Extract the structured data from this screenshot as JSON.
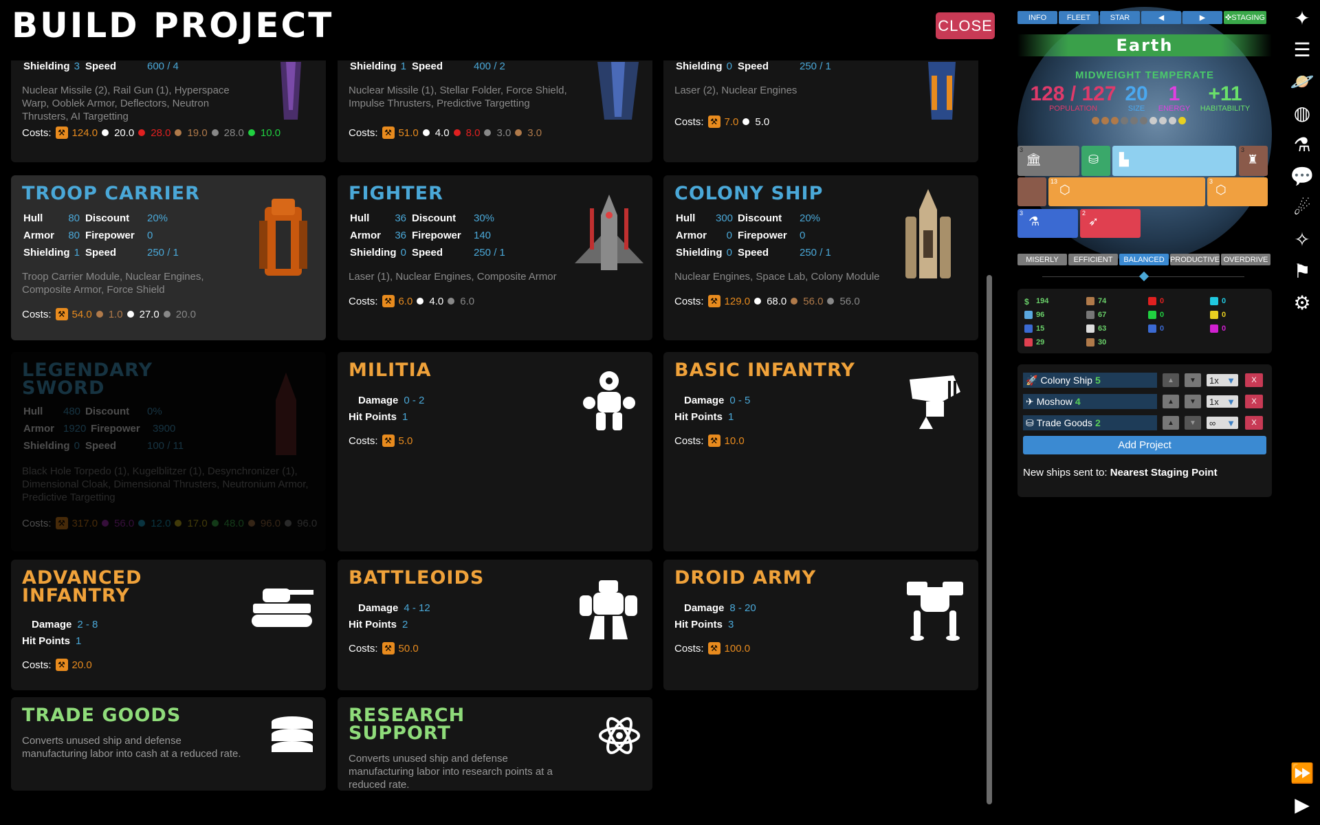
{
  "header": {
    "title": "Build Project",
    "close_label": "CLOSE"
  },
  "top_cards": [
    {
      "shielding": "3",
      "speed": "600 / 4",
      "modules": "Nuclear Missile (2),  Rail Gun (1),  Hyperspace Warp,  Ooblek Armor,  Deflectors,  Neutron Thrusters,  AI Targetting",
      "costs": [
        {
          "v": "124.0",
          "c": "orange",
          "icon": "hammer"
        },
        {
          "v": "20.0",
          "c": "white"
        },
        {
          "v": "28.0",
          "c": "red"
        },
        {
          "v": "19.0",
          "c": "brown"
        },
        {
          "v": "28.0",
          "c": "grey"
        },
        {
          "v": "10.0",
          "c": "green"
        }
      ]
    },
    {
      "shielding": "1",
      "speed": "400 / 2",
      "modules": "Nuclear Missile (1),  Stellar Folder,  Force Shield,  Impulse Thrusters,  Predictive Targetting",
      "costs": [
        {
          "v": "51.0",
          "c": "orange",
          "icon": "hammer"
        },
        {
          "v": "4.0",
          "c": "white"
        },
        {
          "v": "8.0",
          "c": "red"
        },
        {
          "v": "3.0",
          "c": "grey"
        },
        {
          "v": "3.0",
          "c": "brown"
        }
      ]
    },
    {
      "shielding": "0",
      "speed": "250 / 1",
      "modules": "Laser (2),  Nuclear Engines",
      "costs": [
        {
          "v": "7.0",
          "c": "orange",
          "icon": "hammer"
        },
        {
          "v": "5.0",
          "c": "white"
        }
      ]
    }
  ],
  "labels": {
    "hull": "Hull",
    "armor": "Armor",
    "shielding": "Shielding",
    "discount": "Discount",
    "firepower": "Firepower",
    "speed": "Speed",
    "costs": "Costs:",
    "damage": "Damage",
    "hit_points": "Hit Points"
  },
  "ships": [
    {
      "name": "Troop Carrier",
      "hull": "80",
      "armor": "80",
      "shielding": "1",
      "discount": "20%",
      "firepower": "0",
      "speed": "250 / 1",
      "modules": "Troop Carrier Module,  Nuclear Engines,  Composite Armor,  Force Shield",
      "costs": [
        {
          "v": "54.0",
          "c": "orange",
          "icon": "hammer"
        },
        {
          "v": "1.0",
          "c": "brown"
        },
        {
          "v": "27.0",
          "c": "white"
        },
        {
          "v": "20.0",
          "c": "grey"
        }
      ]
    },
    {
      "name": "Fighter",
      "hull": "36",
      "armor": "36",
      "shielding": "0",
      "discount": "30%",
      "firepower": "140",
      "speed": "250 / 1",
      "modules": "Laser (1),  Nuclear Engines,  Composite Armor",
      "costs": [
        {
          "v": "6.0",
          "c": "orange",
          "icon": "hammer"
        },
        {
          "v": "4.0",
          "c": "white"
        },
        {
          "v": "6.0",
          "c": "grey"
        }
      ]
    },
    {
      "name": "Colony Ship",
      "hull": "300",
      "armor": "0",
      "shielding": "0",
      "discount": "20%",
      "firepower": "0",
      "speed": "250 / 1",
      "modules": "Nuclear Engines,  Space Lab,  Colony Module",
      "costs": [
        {
          "v": "129.0",
          "c": "orange",
          "icon": "hammer"
        },
        {
          "v": "68.0",
          "c": "white"
        },
        {
          "v": "56.0",
          "c": "brown"
        },
        {
          "v": "56.0",
          "c": "grey"
        }
      ]
    },
    {
      "name": "Legendary Sword",
      "hull": "480",
      "armor": "1920",
      "shielding": "0",
      "discount": "0%",
      "firepower": "3900",
      "speed": "100 / 11",
      "modules": "Black Hole Torpedo (1),  Kugelblitzer (1),  Desynchronizer (1),  Dimensional Cloak,  Dimensional Thrusters,  Neutronium Armor,  Predictive Targetting",
      "costs": [
        {
          "v": "317.0",
          "c": "orange",
          "icon": "hammer"
        },
        {
          "v": "56.0",
          "c": "purple"
        },
        {
          "v": "12.0",
          "c": "cyan"
        },
        {
          "v": "17.0",
          "c": "yellow"
        },
        {
          "v": "48.0",
          "c": "lgreen"
        },
        {
          "v": "96.0",
          "c": "brown"
        },
        {
          "v": "96.0",
          "c": "grey"
        }
      ]
    }
  ],
  "troops": [
    {
      "name": "Militia",
      "damage": "0 - 2",
      "hp": "1",
      "cost": "5.0"
    },
    {
      "name": "Basic Infantry",
      "damage": "0 - 5",
      "hp": "1",
      "cost": "10.0"
    },
    {
      "name": "Advanced Infantry",
      "damage": "2 - 8",
      "hp": "1",
      "cost": "20.0"
    },
    {
      "name": "Battleoids",
      "damage": "4 - 12",
      "hp": "2",
      "cost": "50.0"
    },
    {
      "name": "Droid Army",
      "damage": "8 - 20",
      "hp": "3",
      "cost": "100.0"
    }
  ],
  "specials": [
    {
      "name": "Trade Goods",
      "desc": "Converts unused ship and defense manufacturing labor into cash at a reduced rate."
    },
    {
      "name": "Research Support",
      "desc": "Converts unused ship and defense manufacturing labor into research points at a reduced rate."
    }
  ],
  "planet": {
    "tabs": [
      "INFO",
      "FLEET",
      "STAR",
      "◀",
      "▶",
      "✜STAGING"
    ],
    "name": "Earth",
    "type": "MIDWEIGHT TEMPERATE",
    "population": "128 / 127",
    "population_label": "POPULATION",
    "size": "20",
    "size_label": "SIZE",
    "energy": "1",
    "energy_label": "ENERGY",
    "habitability": "+11",
    "habitability_label": "HABITABILITY",
    "hex_colors": [
      "#b07a4a",
      "#b07a4a",
      "#b07a4a",
      "#777",
      "#777",
      "#777",
      "#ccc",
      "#ccc",
      "#ccc",
      "#e8d020"
    ],
    "buildings": [
      {
        "n": "3",
        "color": "#777"
      },
      {
        "n": "",
        "color": "#3aa86a"
      },
      {
        "n": "",
        "color": "#8fd0f0"
      },
      {
        "n": "3",
        "color": "#8a5a4a"
      },
      {
        "n": "",
        "color": "#8a5a4a"
      },
      {
        "n": "13",
        "color": "#f0a040"
      },
      {
        "n": "3",
        "color": "#f0a040"
      },
      {
        "n": "3",
        "color": "#3b6ad2"
      },
      {
        "n": "2",
        "color": "#e04050"
      }
    ]
  },
  "modes": [
    "MISERLY",
    "EFFICIENT",
    "BALANCED",
    "PRODUCTIVE",
    "OVERDRIVE"
  ],
  "active_mode": "BALANCED",
  "resources": [
    {
      "label": "$",
      "v": "194",
      "color": "#6ad06a"
    },
    {
      "label": "",
      "v": "74",
      "color": "#b07a4a"
    },
    {
      "label": "",
      "v": "0",
      "color": "#e02020"
    },
    {
      "label": "",
      "v": "0",
      "color": "#20c8e0"
    },
    {
      "label": "",
      "v": "96",
      "color": "#5aa8e0"
    },
    {
      "label": "",
      "v": "67",
      "color": "#777"
    },
    {
      "label": "",
      "v": "0",
      "color": "#20d040"
    },
    {
      "label": "",
      "v": "0",
      "color": "#e8d020"
    },
    {
      "label": "",
      "v": "15",
      "color": "#3b6ad2"
    },
    {
      "label": "",
      "v": "63",
      "color": "#ddd"
    },
    {
      "label": "",
      "v": "0",
      "color": "#3b6ad2"
    },
    {
      "label": "",
      "v": "0",
      "color": "#d020d0"
    },
    {
      "label": "",
      "v": "29",
      "color": "#e04050"
    },
    {
      "label": "",
      "v": "30",
      "color": "#b07a4a"
    }
  ],
  "queue": [
    {
      "name": "Colony Ship",
      "count": "5",
      "mult": "1x"
    },
    {
      "name": "Moshow",
      "count": "4",
      "mult": "1x"
    },
    {
      "name": "Trade Goods",
      "count": "2",
      "mult": "∞"
    }
  ],
  "add_project": "Add Project",
  "sent_to_label": "New ships sent to:",
  "sent_to_value": "Nearest Staging Point"
}
